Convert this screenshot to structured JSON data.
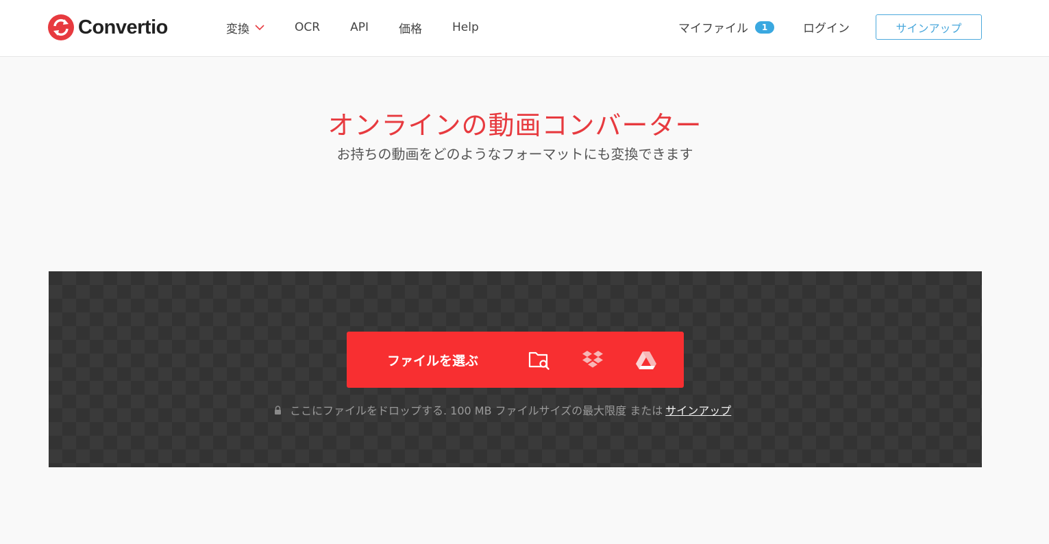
{
  "brand": {
    "name": "Convertio",
    "color": "#e73a3f"
  },
  "nav": {
    "items": [
      {
        "label": "変換",
        "icon": "chevron-down-icon"
      },
      {
        "label": "OCR"
      },
      {
        "label": "API"
      },
      {
        "label": "価格"
      },
      {
        "label": "Help"
      }
    ]
  },
  "account": {
    "myfiles_label": "マイファイル",
    "myfiles_count": "1",
    "login_label": "ログイン",
    "signup_label": "サインアップ"
  },
  "hero": {
    "title": "オンラインの動画コンバーター",
    "subtitle": "お持ちの動画をどのようなフォーマットにも変換できます"
  },
  "upload": {
    "choose_label": "ファイルを選ぶ",
    "sources": [
      "folder-search-icon",
      "dropbox-icon",
      "google-drive-icon"
    ],
    "note_text": "ここにファイルをドロップする. 100 MB ファイルサイズの最大限度 または",
    "note_link": "サインアップ",
    "button_color": "#f82f31"
  }
}
